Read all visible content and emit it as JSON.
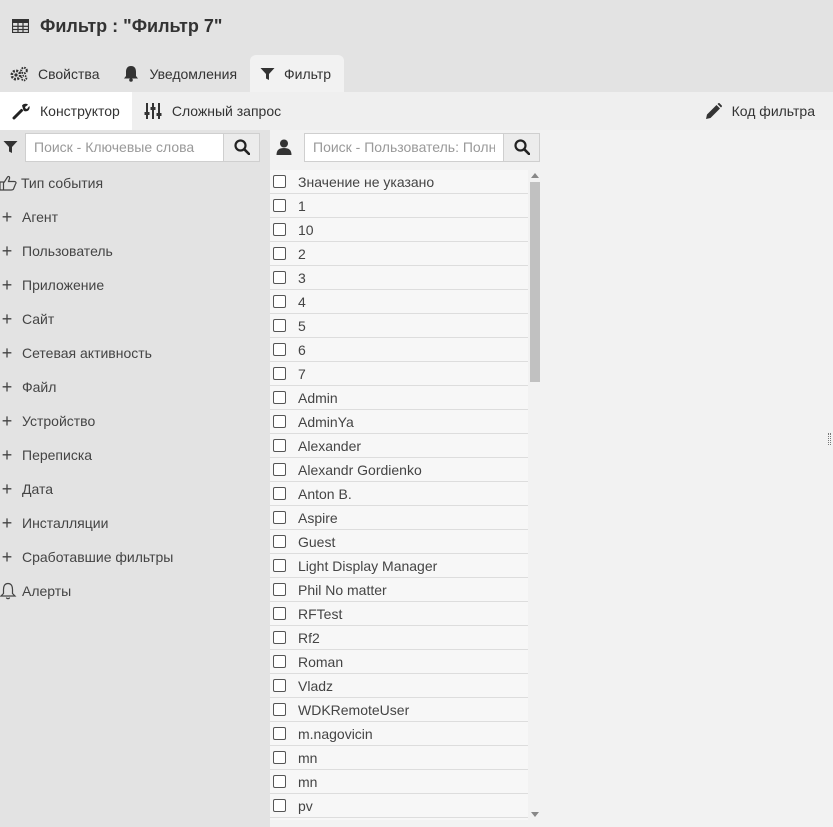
{
  "window": {
    "title": "Фильтр : \"Фильтр 7\"",
    "icon": "table-icon"
  },
  "tabs": [
    {
      "label": "Свойства",
      "icon": "gears-icon",
      "active": false
    },
    {
      "label": "Уведомления",
      "icon": "bell-icon",
      "active": false
    },
    {
      "label": "Фильтр",
      "icon": "funnel-icon",
      "active": true
    }
  ],
  "subtabs": [
    {
      "label": "Конструктор",
      "icon": "wrench-icon",
      "active": true
    },
    {
      "label": "Сложный запрос",
      "icon": "sliders-icon",
      "active": false
    }
  ],
  "code_link": {
    "label": "Код фильтра",
    "icon": "pencil-icon"
  },
  "left_search": {
    "placeholder": "Поиск - Ключевые слова",
    "value": ""
  },
  "right_search": {
    "placeholder": "Поиск - Пользователь: Полное имя",
    "value": ""
  },
  "categories": [
    {
      "label": "Тип события",
      "icon": "thumbs-up-icon"
    },
    {
      "label": "Агент",
      "icon": "plus-icon"
    },
    {
      "label": "Пользователь",
      "icon": "plus-icon"
    },
    {
      "label": "Приложение",
      "icon": "plus-icon"
    },
    {
      "label": "Сайт",
      "icon": "plus-icon"
    },
    {
      "label": "Сетевая активность",
      "icon": "plus-icon"
    },
    {
      "label": "Файл",
      "icon": "plus-icon"
    },
    {
      "label": "Устройство",
      "icon": "plus-icon"
    },
    {
      "label": "Переписка",
      "icon": "plus-icon"
    },
    {
      "label": "Дата",
      "icon": "plus-icon"
    },
    {
      "label": "Инсталляции",
      "icon": "plus-icon"
    },
    {
      "label": "Сработавшие фильтры",
      "icon": "plus-icon"
    },
    {
      "label": "Алерты",
      "icon": "bell-outline-icon"
    }
  ],
  "values": [
    "Значение не указано",
    "1",
    "10",
    "2",
    "3",
    "4",
    "5",
    "6",
    "7",
    "Admin",
    "AdminYa",
    "Alexander",
    "Alexandr Gordienko",
    "Anton B.",
    "Aspire",
    "Guest",
    "Light Display Manager",
    "Phil No matter",
    "RFTest",
    "Rf2",
    "Roman",
    "Vladz",
    "WDKRemoteUser",
    "m.nagovicin",
    "mn",
    "mn",
    "pv"
  ]
}
